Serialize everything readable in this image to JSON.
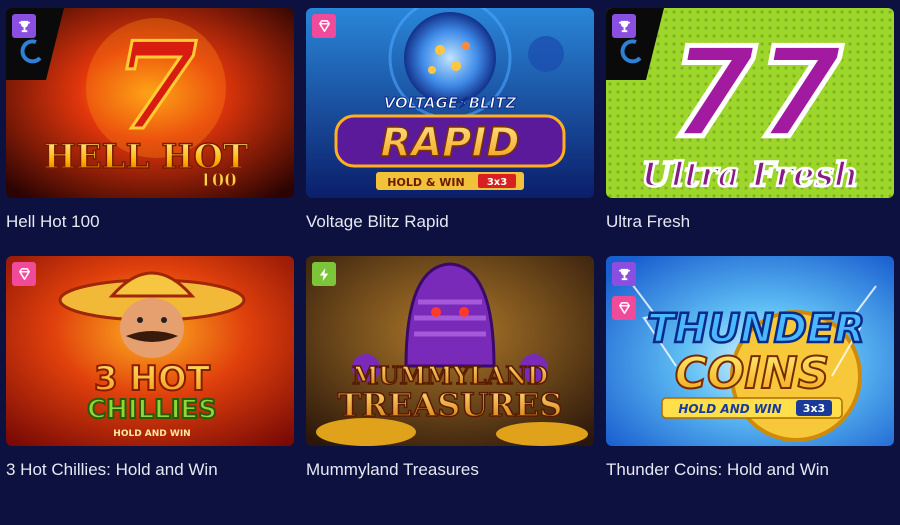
{
  "games": [
    {
      "title": "Hell Hot 100",
      "badges": [
        "trophy-icon"
      ],
      "logo": {
        "big": "7",
        "line1": "HELL HOT",
        "line2": "100"
      },
      "colors": {
        "bg1": "#2a0302",
        "bg2": "#d8290a"
      }
    },
    {
      "title": "Voltage Blitz Rapid",
      "badges": [
        "gem-icon"
      ],
      "logo": {
        "top": "VOLTAGE⚡BLITZ",
        "main": "RAPID",
        "sub": "HOLD & WIN",
        "tag": "3x3"
      },
      "colors": {
        "bg1": "#0b1e6a",
        "bg2": "#2a86d8"
      }
    },
    {
      "title": "Ultra Fresh",
      "badges": [
        "trophy-icon"
      ],
      "logo": {
        "big": "77",
        "line1": "Ultra Fresh"
      },
      "colors": {
        "bg1": "#7fc21e",
        "bg2": "#b6e83a"
      }
    },
    {
      "title": "3 Hot Chillies: Hold and Win",
      "badges": [
        "gem-icon"
      ],
      "logo": {
        "line1": "3 HOT",
        "line2": "CHILLIES",
        "sub": "HOLD AND WIN"
      },
      "colors": {
        "bg1": "#7a0a05",
        "bg2": "#f05a12"
      }
    },
    {
      "title": "Mummyland Treasures",
      "badges": [
        "bolt-icon"
      ],
      "logo": {
        "line1": "MUMMYLAND",
        "line2": "TREASURES"
      },
      "colors": {
        "bg1": "#2a160a",
        "bg2": "#8a5a1c"
      }
    },
    {
      "title": "Thunder Coins: Hold and Win",
      "badges": [
        "trophy-icon",
        "gem-icon"
      ],
      "logo": {
        "line1": "THUNDER",
        "line2": "COINS",
        "sub": "HOLD AND WIN",
        "tag": "3x3"
      },
      "colors": {
        "bg1": "#1a5fd0",
        "bg2": "#7fd6ff"
      }
    }
  ]
}
